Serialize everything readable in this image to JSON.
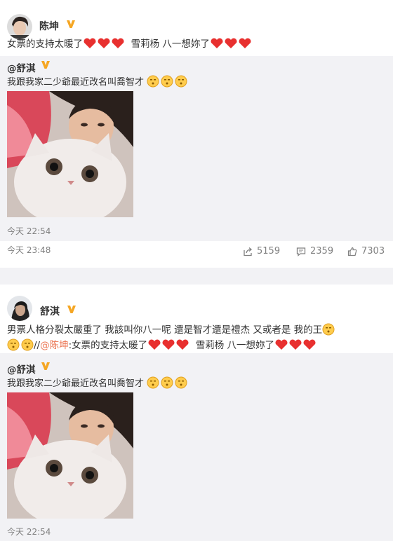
{
  "posts": [
    {
      "author": "陈坤",
      "text_a": "女票的支持太暖了",
      "text_b": "雪莉杨 八一想妳了",
      "repost": {
        "author": "@舒淇",
        "text": "我跟我家二少爺最近改名叫喬智才",
        "time": "今天 22:54"
      },
      "time": "今天 23:48",
      "actions": {
        "share": "5159",
        "comment": "2359",
        "like": "7303"
      }
    },
    {
      "author": "舒淇",
      "line1": "男票人格分裂太嚴重了 我該叫你八一呢 還是智才還是禮杰 又或者是 我的王",
      "line2_slash": "//",
      "line2_mention": "@陈坤",
      "line2_a": ":女票的支持太暖了",
      "line2_b": "雪莉杨 八一想妳了",
      "repost": {
        "author": "@舒淇",
        "text": "我跟我家二少爺最近改名叫喬智才",
        "time": "今天 22:54"
      }
    }
  ],
  "icons": {
    "verified": "verified-badge-icon",
    "share": "share-icon",
    "comment": "comment-icon",
    "like": "thumb-up-icon"
  },
  "colors": {
    "mention": "#eb7350",
    "badge": "#f5a623",
    "heart": "#e8302f",
    "repost_bg": "#f2f2f5"
  }
}
